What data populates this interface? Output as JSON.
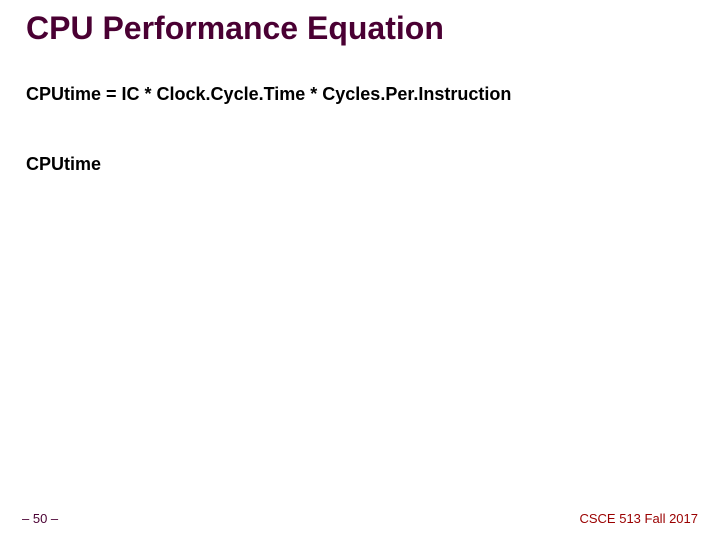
{
  "slide": {
    "title": "CPU Performance Equation",
    "equation": "CPUtime = IC * Clock.Cycle.Time * Cycles.Per.Instruction",
    "subhead": "CPUtime"
  },
  "footer": {
    "slide_number": "– 50 –",
    "course": "CSCE 513 Fall 2017"
  }
}
